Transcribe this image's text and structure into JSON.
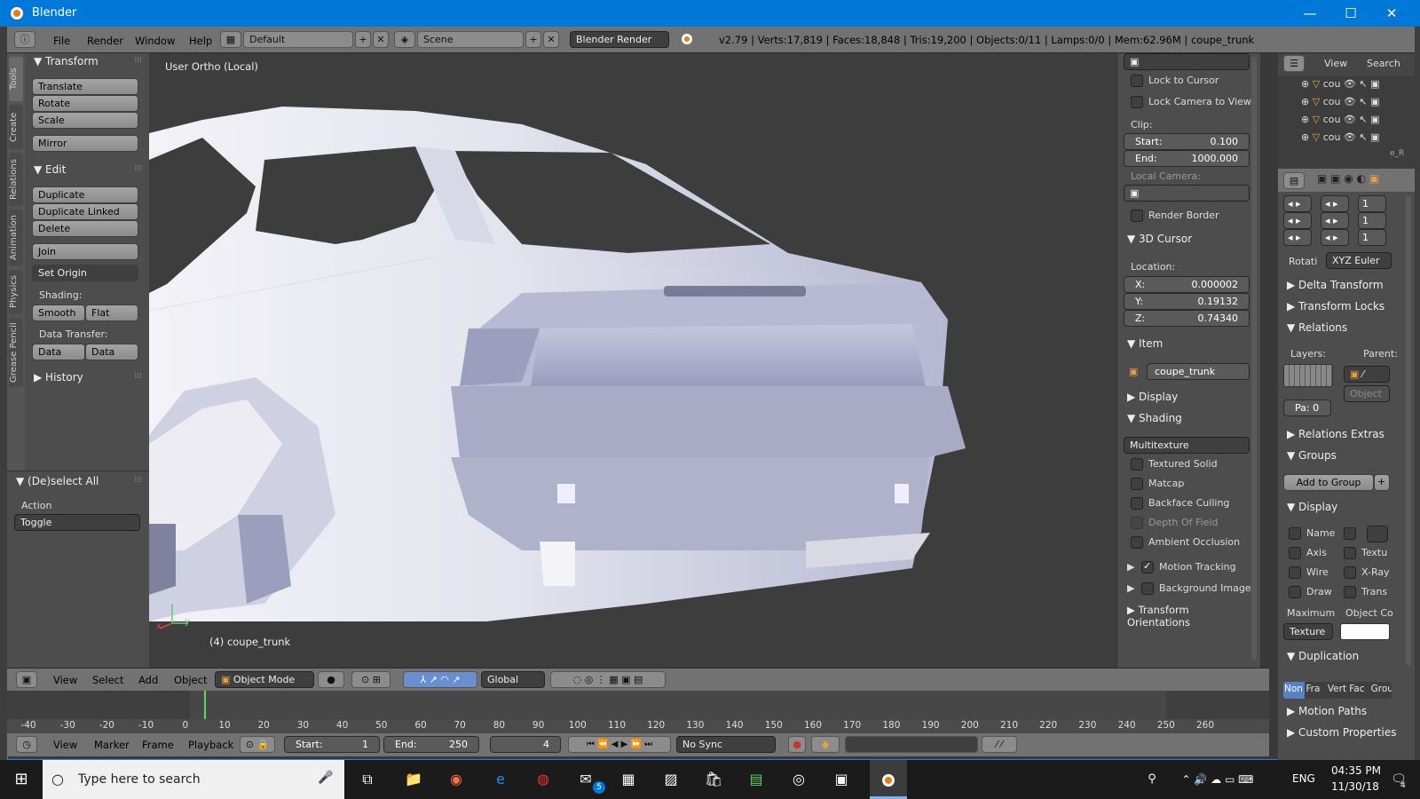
{
  "window": {
    "title": "Blender",
    "minimize": "—",
    "maximize": "☐",
    "close": "✕"
  },
  "topbar": {
    "menus": [
      "File",
      "Render",
      "Window",
      "Help"
    ],
    "screen_layout": "Default",
    "scene": "Scene",
    "engine": "Blender Render",
    "status": "v2.79 | Verts:17,819 | Faces:18,848 | Tris:19,200 | Objects:0/11 | Lamps:0/0 | Mem:62.96M | coupe_trunk"
  },
  "left_tabs": [
    "Tools",
    "Create",
    "Relations",
    "Animation",
    "Physics",
    "Grease Pencil"
  ],
  "toolshelf": {
    "transform_header": "Transform",
    "translate": "Translate",
    "rotate": "Rotate",
    "scale": "Scale",
    "mirror": "Mirror",
    "edit_header": "Edit",
    "duplicate": "Duplicate",
    "duplicate_linked": "Duplicate Linked",
    "delete": "Delete",
    "join": "Join",
    "set_origin": "Set Origin",
    "shading_label": "Shading:",
    "smooth": "Smooth",
    "flat": "Flat",
    "data_transfer_label": "Data Transfer:",
    "data": "Data",
    "data_layout": "Data Layo",
    "history_header": "History",
    "deselect_header": "(De)select All",
    "action_label": "Action",
    "action_value": "Toggle"
  },
  "viewport": {
    "view_label": "User Ortho (Local)",
    "object_label": "(4) coupe_trunk",
    "axis_x": "x",
    "axis_y": "y"
  },
  "npanel": {
    "lock_to_cursor": "Lock to Cursor",
    "lock_camera": "Lock Camera to View",
    "clip_label": "Clip:",
    "clip_start_label": "Start:",
    "clip_start": "0.100",
    "clip_end_label": "End:",
    "clip_end": "1000.000",
    "local_camera_label": "Local Camera:",
    "render_border": "Render Border",
    "cursor_header": "3D Cursor",
    "location_label": "Location:",
    "x_label": "X:",
    "x": "0.000002",
    "y_label": "Y:",
    "y": "0.19132",
    "z_label": "Z:",
    "z": "0.74340",
    "item_header": "Item",
    "item_name": "coupe_trunk",
    "display_header": "Display",
    "shading_header": "Shading",
    "shading_mode": "Multitexture",
    "textured_solid": "Textured Solid",
    "matcap": "Matcap",
    "backface_culling": "Backface Culling",
    "depth_of_field": "Depth Of Field",
    "ambient_occlusion": "Ambient Occlusion",
    "motion_tracking": "Motion Tracking",
    "background_images": "Background Images",
    "transform_orientations": "Transform Orientations"
  },
  "outliner": {
    "view": "View",
    "search": "Search",
    "items": [
      "cou",
      "cou",
      "cou",
      "cou"
    ],
    "partial": "e_R"
  },
  "properties": {
    "steps": [
      "1",
      "1",
      "1"
    ],
    "rotation_label": "Rotati",
    "rotation_mode": "XYZ Euler",
    "delta_transform": "Delta Transform",
    "transform_locks": "Transform Locks",
    "relations": "Relations",
    "layers_label": "Layers:",
    "parent_label": "Parent:",
    "parent_type": "Object",
    "pass_index": "Pa: 0",
    "relations_extras": "Relations Extras",
    "groups": "Groups",
    "add_to_group": "Add to Group",
    "display": "Display",
    "disp_name": "Name",
    "disp_axis": "Axis",
    "disp_texture": "Textu",
    "disp_wire": "Wire",
    "disp_xray": "X-Ray",
    "disp_draw": "Draw",
    "disp_trans": "Trans",
    "maximum_label": "Maximum",
    "object_color_label": "Object Co",
    "max_draw_type": "Texture",
    "duplication": "Duplication",
    "dup_options": [
      "Non",
      "Fra",
      "Vert",
      "Fac",
      "Grou"
    ],
    "motion_paths": "Motion Paths",
    "custom_properties": "Custom Properties"
  },
  "vpheader": {
    "menus": [
      "View",
      "Select",
      "Add",
      "Object"
    ],
    "mode": "Object Mode",
    "orientation": "Global"
  },
  "timeline": {
    "ticks": [
      "-40",
      "-30",
      "-20",
      "-10",
      "0",
      "10",
      "20",
      "30",
      "40",
      "50",
      "60",
      "70",
      "80",
      "90",
      "100",
      "110",
      "120",
      "130",
      "140",
      "150",
      "160",
      "170",
      "180",
      "190",
      "200",
      "210",
      "220",
      "230",
      "240",
      "250",
      "260"
    ],
    "current_frame_marker": 4
  },
  "tlheader": {
    "menus": [
      "View",
      "Marker",
      "Frame",
      "Playback"
    ],
    "start_label": "Start:",
    "start": "1",
    "end_label": "End:",
    "end": "250",
    "current": "4",
    "sync": "No Sync"
  },
  "taskbar": {
    "search_placeholder": "Type here to search",
    "mail_badge": "5",
    "lang": "ENG",
    "time": "04:35 PM",
    "date": "11/30/18",
    "notif_count": "4"
  },
  "colors": {
    "accent": "#0078d7",
    "blender_orange": "#e87d0d",
    "panel": "#4d4d4d",
    "header": "#727272"
  }
}
